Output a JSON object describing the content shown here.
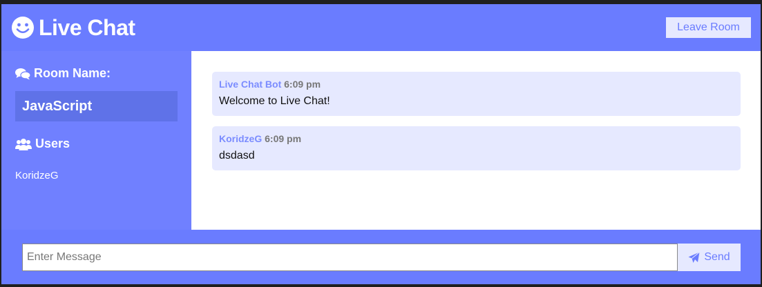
{
  "header": {
    "title": "Live Chat",
    "leave_label": "Leave Room"
  },
  "sidebar": {
    "room_heading": "Room Name:",
    "room_name": "JavaScript",
    "users_heading": "Users",
    "users": [
      "KoridzeG"
    ]
  },
  "messages": [
    {
      "author": "Live Chat Bot",
      "time": "6:09 pm",
      "text": "Welcome to Live Chat!"
    },
    {
      "author": "KoridzeG",
      "time": "6:09 pm",
      "text": "dsdasd"
    }
  ],
  "composer": {
    "placeholder": "Enter Message",
    "send_label": "Send"
  },
  "colors": {
    "primary": "#6a7cff",
    "sidebar": "#7080ff",
    "room_box": "#5f72e8",
    "light": "#e6e9ff"
  },
  "icons": {
    "brand": "smile-icon",
    "room": "comments-icon",
    "users": "users-icon",
    "send": "paper-plane-icon"
  }
}
